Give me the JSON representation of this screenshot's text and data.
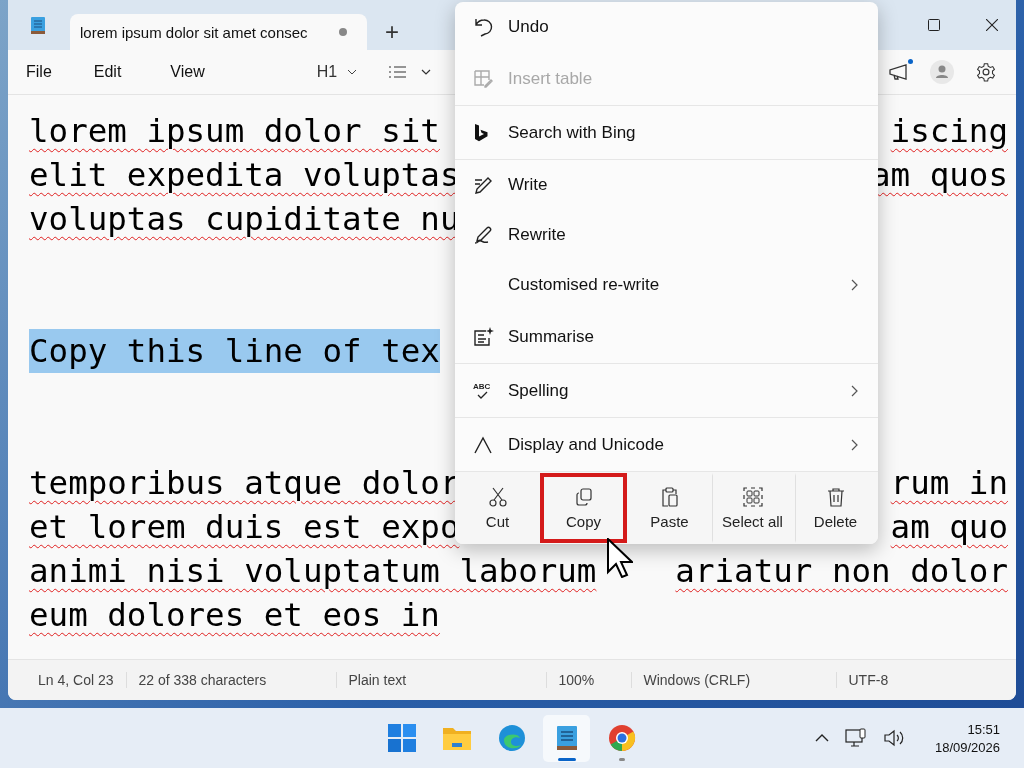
{
  "window": {
    "tab_title": "lorem ipsum dolor sit amet consec",
    "unsaved": true,
    "new_tab": "+"
  },
  "menu_bar": [
    "File",
    "Edit",
    "View"
  ],
  "toolbar": {
    "heading": "H1",
    "notification": true
  },
  "document": {
    "lines": [
      {
        "kind": "text",
        "segments": [
          "lorem ipsum dolor sit",
          "iscing"
        ],
        "selected": false
      },
      {
        "kind": "text",
        "segments": [
          "elit expedita voluptas",
          "am quos"
        ],
        "selected": false
      },
      {
        "kind": "text",
        "segments": [
          "voluptas cupiditate nu"
        ],
        "selected": false
      },
      {
        "kind": "blank"
      },
      {
        "kind": "blank"
      },
      {
        "kind": "text",
        "segments": [
          "Copy this line of tex"
        ],
        "selected": true
      },
      {
        "kind": "blank"
      },
      {
        "kind": "blank"
      },
      {
        "kind": "text",
        "segments": [
          "temporibus atque dolor",
          "rum in"
        ],
        "selected": false
      },
      {
        "kind": "text",
        "segments": [
          "et lorem duis est expo",
          "am quo"
        ],
        "selected": false
      },
      {
        "kind": "text",
        "segments": [
          "animi nisi voluptatum laborum",
          "ariatur non dolor"
        ],
        "selected": false
      },
      {
        "kind": "text",
        "segments": [
          "eum dolores et eos in"
        ],
        "selected": false
      }
    ]
  },
  "context_menu": {
    "items": [
      {
        "label": "Undo",
        "disabled": false,
        "submenu": false,
        "separator_after": false
      },
      {
        "label": "Insert table",
        "disabled": true,
        "submenu": false,
        "separator_after": true
      },
      {
        "label": "Search with Bing",
        "disabled": false,
        "submenu": false,
        "separator_after": true
      },
      {
        "label": "Write",
        "disabled": false,
        "submenu": false,
        "separator_after": false
      },
      {
        "label": "Rewrite",
        "disabled": false,
        "submenu": false,
        "separator_after": false
      },
      {
        "label": "Customised re-write",
        "disabled": false,
        "submenu": true,
        "separator_after": false
      },
      {
        "label": "Summarise",
        "disabled": false,
        "submenu": false,
        "separator_after": true
      },
      {
        "icon_text": "ABC",
        "label": "Spelling",
        "disabled": false,
        "submenu": true,
        "separator_after": true
      },
      {
        "label": "Display and Unicode",
        "disabled": false,
        "submenu": true,
        "separator_after": true
      }
    ],
    "actions": [
      {
        "label": "Cut",
        "highlighted": false
      },
      {
        "label": "Copy",
        "highlighted": true
      },
      {
        "label": "Paste",
        "highlighted": false
      },
      {
        "label": "Select all",
        "highlighted": false
      },
      {
        "label": "Delete",
        "highlighted": false
      }
    ]
  },
  "status_bar": [
    "Ln 4, Col 23",
    "22 of 338 characters",
    "Plain text",
    "100%",
    "Windows (CRLF)",
    "UTF-8"
  ],
  "taskbar": {
    "apps": [
      {
        "kind": "start",
        "active": false
      },
      {
        "kind": "explorer",
        "active": false
      },
      {
        "kind": "edge",
        "active": false
      },
      {
        "kind": "notepad",
        "active": true
      },
      {
        "kind": "chrome",
        "active": false,
        "running": true
      }
    ],
    "time": "15:51",
    "date": "18/09/2026"
  }
}
